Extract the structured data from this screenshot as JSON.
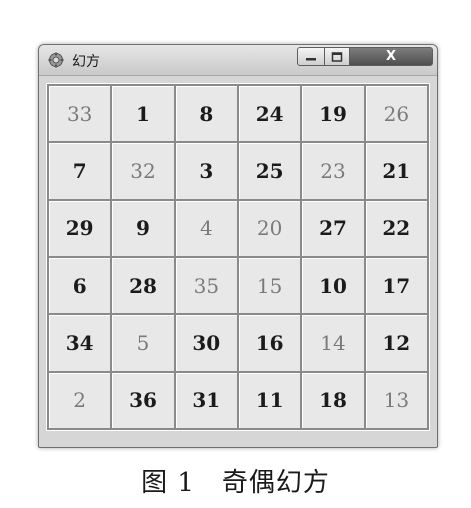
{
  "window": {
    "title": "幻方",
    "icon": "gear-icon",
    "controls": {
      "minimize": "minimize-icon",
      "maximize": "maximize-icon",
      "close_label": "X"
    }
  },
  "grid": {
    "rows": [
      [
        {
          "v": "33",
          "light": true
        },
        {
          "v": "1",
          "light": false
        },
        {
          "v": "8",
          "light": false
        },
        {
          "v": "24",
          "light": false
        },
        {
          "v": "19",
          "light": false
        },
        {
          "v": "26",
          "light": true
        }
      ],
      [
        {
          "v": "7",
          "light": false
        },
        {
          "v": "32",
          "light": true
        },
        {
          "v": "3",
          "light": false
        },
        {
          "v": "25",
          "light": false
        },
        {
          "v": "23",
          "light": true
        },
        {
          "v": "21",
          "light": false
        }
      ],
      [
        {
          "v": "29",
          "light": false
        },
        {
          "v": "9",
          "light": false
        },
        {
          "v": "4",
          "light": true
        },
        {
          "v": "20",
          "light": true
        },
        {
          "v": "27",
          "light": false
        },
        {
          "v": "22",
          "light": false
        }
      ],
      [
        {
          "v": "6",
          "light": false
        },
        {
          "v": "28",
          "light": false
        },
        {
          "v": "35",
          "light": true
        },
        {
          "v": "15",
          "light": true
        },
        {
          "v": "10",
          "light": false
        },
        {
          "v": "17",
          "light": false
        }
      ],
      [
        {
          "v": "34",
          "light": false
        },
        {
          "v": "5",
          "light": true
        },
        {
          "v": "30",
          "light": false
        },
        {
          "v": "16",
          "light": false
        },
        {
          "v": "14",
          "light": true
        },
        {
          "v": "12",
          "light": false
        }
      ],
      [
        {
          "v": "2",
          "light": true
        },
        {
          "v": "36",
          "light": false
        },
        {
          "v": "31",
          "light": false
        },
        {
          "v": "11",
          "light": false
        },
        {
          "v": "18",
          "light": false
        },
        {
          "v": "13",
          "light": true
        }
      ]
    ]
  },
  "caption": "图 1　奇偶幻方",
  "colors": {
    "dark_number": "#1b1b1b",
    "light_number": "#7a7a7a"
  }
}
